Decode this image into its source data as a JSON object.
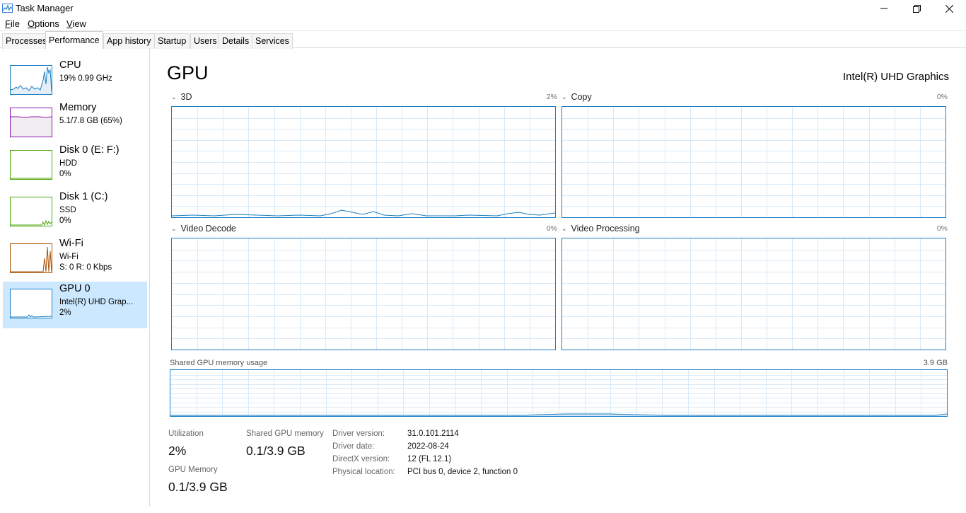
{
  "window": {
    "title": "Task Manager",
    "icon": "task-manager-icon"
  },
  "menu": [
    {
      "label": "File",
      "accel": "F",
      "rest": "ile"
    },
    {
      "label": "Options",
      "accel": "O",
      "rest": "ptions"
    },
    {
      "label": "View",
      "accel": "V",
      "rest": "iew"
    }
  ],
  "tabs": [
    "Processes",
    "Performance",
    "App history",
    "Startup",
    "Users",
    "Details",
    "Services"
  ],
  "active_tab": "Performance",
  "sidebar": [
    {
      "title": "CPU",
      "line2": "19%  0.99 GHz",
      "line3": "",
      "border": "#1a7fc2",
      "fill": "#f1f6fb"
    },
    {
      "title": "Memory",
      "line2": "5.1/7.8 GB (65%)",
      "line3": "",
      "border": "#8b12ae",
      "fill": "#f4f2f4"
    },
    {
      "title": "Disk 0 (E: F:)",
      "line2": "HDD",
      "line3": "0%",
      "border": "#4da60c",
      "fill": "#ffffff"
    },
    {
      "title": "Disk 1 (C:)",
      "line2": "SSD",
      "line3": "0%",
      "border": "#4da60c",
      "fill": "#ffffff"
    },
    {
      "title": "Wi-Fi",
      "line2": "Wi-Fi",
      "line3": "S: 0  R: 0 Kbps",
      "border": "#a74f01",
      "fill": "#ffffff"
    },
    {
      "title": "GPU 0",
      "line2": "Intel(R) UHD Grap...",
      "line3": "2%",
      "border": "#1a7fc2",
      "fill": "#ffffff"
    }
  ],
  "main": {
    "title": "GPU",
    "device_name": "Intel(R) UHD Graphics",
    "engines": [
      {
        "name": "3D",
        "pct": "2%"
      },
      {
        "name": "Copy",
        "pct": "0%"
      },
      {
        "name": "Video Decode",
        "pct": "0%"
      },
      {
        "name": "Video Processing",
        "pct": "0%"
      }
    ],
    "shared_memory": {
      "label": "Shared GPU memory usage",
      "max": "3.9 GB"
    },
    "stats": {
      "utilization_label": "Utilization",
      "utilization_value": "2%",
      "shared_label": "Shared GPU memory",
      "shared_value": "0.1/3.9 GB",
      "gpu_mem_label": "GPU Memory",
      "gpu_mem_value": "0.1/3.9 GB"
    },
    "info": [
      {
        "label": "Driver version:",
        "value": "31.0.101.2114"
      },
      {
        "label": "Driver date:",
        "value": "2022-08-24"
      },
      {
        "label": "DirectX version:",
        "value": "12 (FL 12.1)"
      },
      {
        "label": "Physical location:",
        "value": "PCI bus 0, device 2, function 0"
      }
    ]
  },
  "colors": {
    "accent": "#1a7fc2",
    "grid": "#d9eaf7",
    "selected_bg": "#cce8ff"
  }
}
